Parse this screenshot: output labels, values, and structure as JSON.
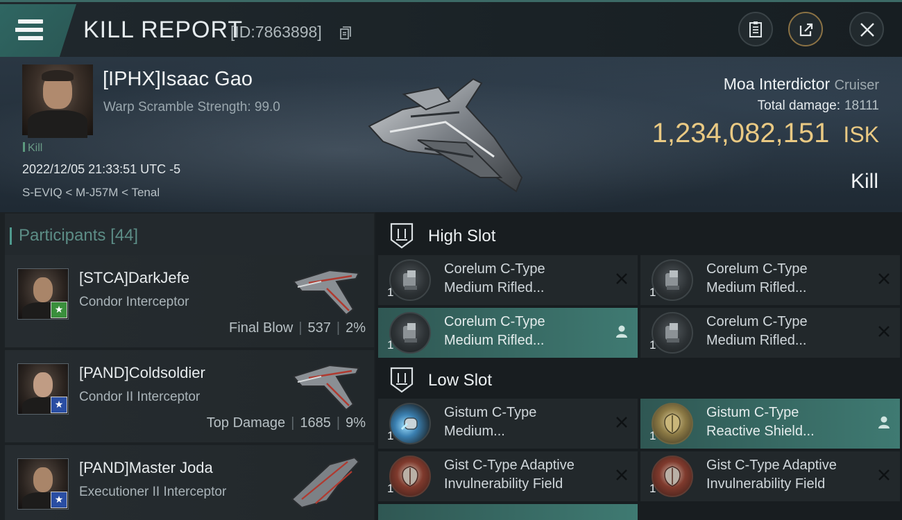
{
  "header": {
    "title": "KILL REPORT",
    "report_id": "[ID:7863898]"
  },
  "victim": {
    "name": "[IPHX]Isaac Gao",
    "subtitle": "Warp Scramble Strength: 99.0",
    "tag": "Kill",
    "date": "2022/12/05 21:33:51 UTC -5",
    "location": "S-EVIQ < M-J57M < Tenal",
    "ship_name": "Moa Interdictor",
    "ship_class": "Cruiser",
    "total_damage_label": "Total damage:",
    "total_damage": "18111",
    "isk_value": "1,234,082,151",
    "isk_unit": "ISK",
    "result": "Kill"
  },
  "participants": {
    "label": "Participants",
    "count": "[44]",
    "rows": [
      {
        "name": "[STCA]DarkJefe",
        "ship": "Condor Interceptor",
        "stat_label": "Final Blow",
        "damage": "537",
        "percent": "2%",
        "badge": "★"
      },
      {
        "name": "[PAND]Coldsoldier",
        "ship": "Condor II Interceptor",
        "stat_label": "Top Damage",
        "damage": "1685",
        "percent": "9%",
        "badge": "★"
      },
      {
        "name": "[PAND]Master Joda",
        "ship": "Executioner II Interceptor",
        "badge": "★"
      }
    ]
  },
  "fitting": {
    "high_slot": {
      "title": "High Slot",
      "modules": [
        {
          "qty": "1",
          "name_line1": "Corelum C-Type",
          "name_line2": "Medium Rifled..."
        },
        {
          "qty": "1",
          "name_line1": "Corelum C-Type",
          "name_line2": "Medium Rifled..."
        },
        {
          "qty": "1",
          "name_line1": "Corelum C-Type",
          "name_line2": "Medium Rifled..."
        },
        {
          "qty": "1",
          "name_line1": "Corelum C-Type",
          "name_line2": "Medium Rifled..."
        }
      ]
    },
    "low_slot": {
      "title": "Low Slot",
      "modules": [
        {
          "qty": "1",
          "name_line1": "Gistum C-Type",
          "name_line2": "Medium..."
        },
        {
          "qty": "1",
          "name_line1": "Gistum C-Type",
          "name_line2": "Reactive Shield..."
        },
        {
          "qty": "1",
          "name_line1": "Gist C-Type Adaptive",
          "name_line2": "Invulnerability Field"
        },
        {
          "qty": "1",
          "name_line1": "Gist C-Type Adaptive",
          "name_line2": "Invulnerability Field"
        }
      ]
    }
  },
  "colors": {
    "accent_teal": "#3f7a72",
    "isk_gold": "#e9c983",
    "badge_green": "#3a8f3c",
    "badge_blue": "#2a4ea3"
  },
  "icons": [
    "menu-icon",
    "copy-icon",
    "clipboard-icon",
    "share-icon",
    "close-icon",
    "slot-icon",
    "remove-icon",
    "pilot-icon"
  ]
}
